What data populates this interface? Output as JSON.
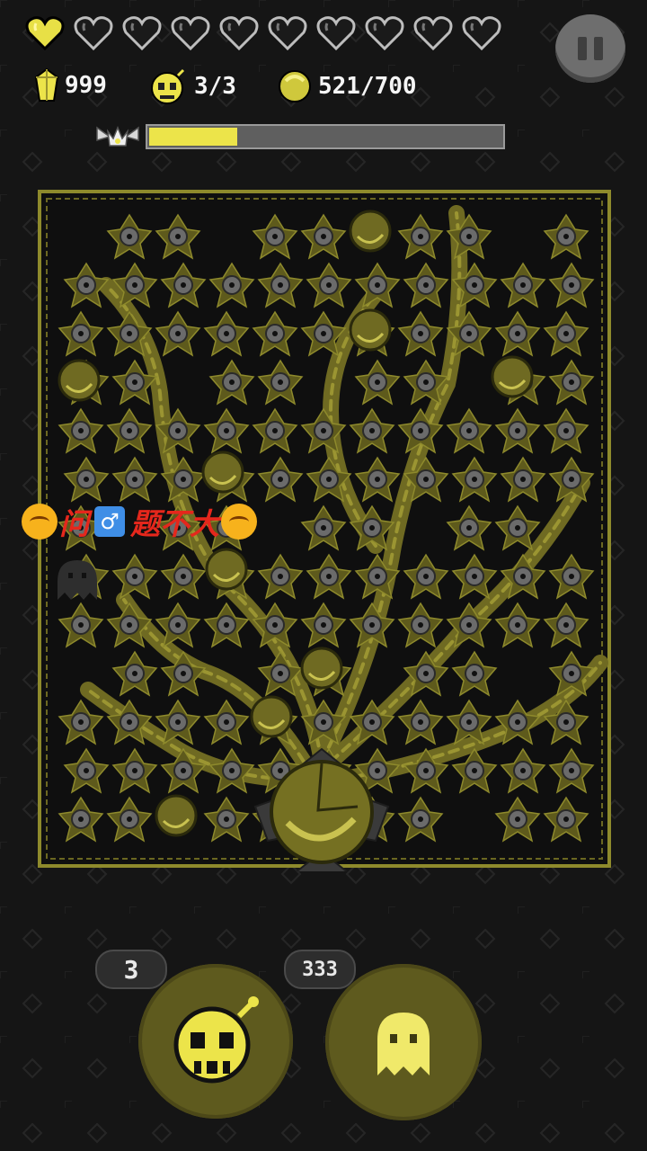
{
  "hud": {
    "hearts_total": 10,
    "hearts_filled": 1,
    "gems_value": "999",
    "skulls_value": "3/3",
    "coins_value": "521/700",
    "level_progress": 0.25
  },
  "icons": {
    "heart": "heart-icon",
    "gem": "gem-icon",
    "skull_bomb": "skull-bomb-icon",
    "coin": "coin-icon",
    "crown": "winged-crown-icon",
    "pause": "pause-icon",
    "ghost": "ghost-icon"
  },
  "caption": {
    "part1": "问",
    "part2": "题不大"
  },
  "abilities": {
    "skull_count": "3",
    "ghost_count": "333"
  },
  "colors": {
    "accent_yellow": "#ece44a",
    "plant_olive": "#6f6a22",
    "eye_grey": "#6b6b6b",
    "caption_red": "#e5271c"
  }
}
